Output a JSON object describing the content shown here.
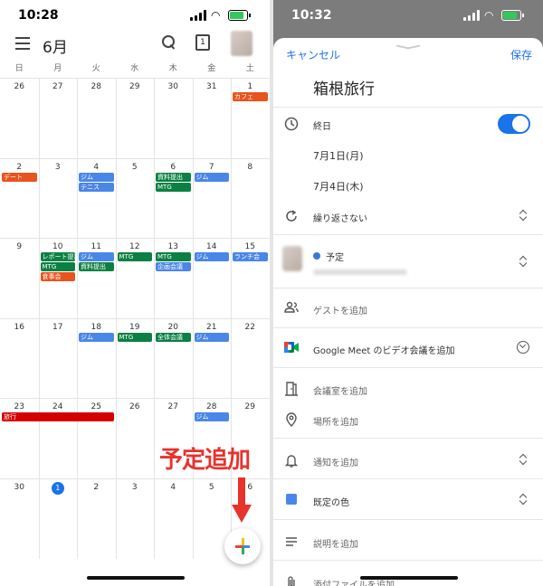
{
  "left": {
    "status_time": "10:28",
    "month": "6月",
    "today_icon_num": "1",
    "weekdays": [
      "日",
      "月",
      "火",
      "水",
      "木",
      "金",
      "土"
    ],
    "weeks": [
      [
        "26",
        "27",
        "28",
        "29",
        "30",
        "31",
        "1"
      ],
      [
        "2",
        "3",
        "4",
        "5",
        "6",
        "7",
        "8"
      ],
      [
        "9",
        "10",
        "11",
        "12",
        "13",
        "14",
        "15"
      ],
      [
        "16",
        "17",
        "18",
        "19",
        "20",
        "21",
        "22"
      ],
      [
        "23",
        "24",
        "25",
        "26",
        "27",
        "28",
        "29"
      ],
      [
        "30",
        "1",
        "2",
        "3",
        "4",
        "5",
        "6"
      ]
    ],
    "events": [
      {
        "label": "カフェ",
        "color": "#e8541e"
      },
      {
        "label": "デート",
        "color": "#e8541e"
      },
      {
        "label": "ジム",
        "color": "#4a86e8"
      },
      {
        "label": "テニス",
        "color": "#4a86e8"
      },
      {
        "label": "資料提出",
        "color": "#0b8043"
      },
      {
        "label": "MTG",
        "color": "#0b8043"
      },
      {
        "label": "ジム",
        "color": "#4a86e8"
      },
      {
        "label": "レポート提出",
        "color": "#0b8043"
      },
      {
        "label": "MTG",
        "color": "#0b8043"
      },
      {
        "label": "食事会",
        "color": "#e8541e"
      },
      {
        "label": "ジム",
        "color": "#4a86e8"
      },
      {
        "label": "資料提出",
        "color": "#0b8043"
      },
      {
        "label": "MTG",
        "color": "#0b8043"
      },
      {
        "label": "MTG",
        "color": "#0b8043"
      },
      {
        "label": "企画会議",
        "color": "#4a86e8"
      },
      {
        "label": "ジム",
        "color": "#4a86e8"
      },
      {
        "label": "ランチ会",
        "color": "#4a86e8"
      },
      {
        "label": "ジム",
        "color": "#4a86e8"
      },
      {
        "label": "MTG",
        "color": "#0b8043"
      },
      {
        "label": "全体会議",
        "color": "#0b8043"
      },
      {
        "label": "ジム",
        "color": "#4a86e8"
      },
      {
        "label": "旅行",
        "color": "#d50000"
      },
      {
        "label": "ジム",
        "color": "#4a86e8"
      }
    ],
    "annotation": "予定追加"
  },
  "right": {
    "status_time": "10:32",
    "cancel": "キャンセル",
    "save": "保存",
    "title": "箱根旅行",
    "all_day": "終日",
    "all_day_on": true,
    "start_date": "7月1日(月)",
    "end_date": "7月4日(木)",
    "repeat": "繰り返さない",
    "calendar_label": "予定",
    "add_guest": "ゲストを追加",
    "meet": "Google Meet のビデオ会議を追加",
    "add_room": "会議室を追加",
    "add_location": "場所を追加",
    "add_notification": "通知を追加",
    "default_color": "既定の色",
    "add_description": "説明を追加",
    "add_attachment": "添付ファイルを追加"
  }
}
